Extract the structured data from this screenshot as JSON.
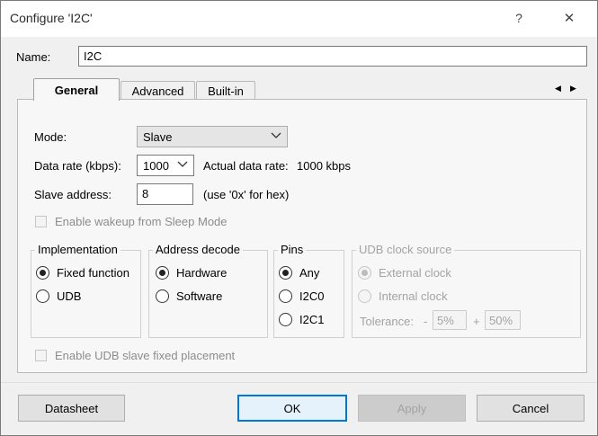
{
  "window": {
    "title": "Configure 'I2C'",
    "help_glyph": "?",
    "close_glyph": "✕"
  },
  "name_field": {
    "label": "Name:",
    "value": "I2C"
  },
  "tabs": [
    {
      "label": "General",
      "active": true
    },
    {
      "label": "Advanced",
      "active": false
    },
    {
      "label": "Built-in",
      "active": false
    }
  ],
  "tab_scroll": {
    "left": "◀",
    "right": "▶"
  },
  "general": {
    "mode": {
      "label": "Mode:",
      "value": "Slave"
    },
    "data_rate": {
      "label": "Data rate (kbps):",
      "value": "1000",
      "actual_label": "Actual data rate:",
      "actual_value": "1000 kbps"
    },
    "slave_address": {
      "label": "Slave address:",
      "value": "8",
      "hint": "(use '0x' for hex)"
    },
    "wakeup": {
      "label": "Enable wakeup from Sleep Mode",
      "checked": false,
      "enabled": false
    },
    "implementation": {
      "title": "Implementation",
      "options": [
        "Fixed function",
        "UDB"
      ],
      "selected": "Fixed function"
    },
    "address_decode": {
      "title": "Address decode",
      "options": [
        "Hardware",
        "Software"
      ],
      "selected": "Hardware"
    },
    "pins": {
      "title": "Pins",
      "options": [
        "Any",
        "I2C0",
        "I2C1"
      ],
      "selected": "Any"
    },
    "udb_clock": {
      "title": "UDB clock source",
      "options": [
        "External clock",
        "Internal clock"
      ],
      "selected": "External clock",
      "tolerance_label": "Tolerance:",
      "minus": "-",
      "plus": "+",
      "minus_value": "5%",
      "plus_value": "50%"
    },
    "fixed_placement": {
      "label": "Enable UDB slave fixed placement",
      "checked": false,
      "enabled": false
    }
  },
  "buttons": {
    "datasheet": "Datasheet",
    "ok": "OK",
    "apply": "Apply",
    "cancel": "Cancel"
  },
  "colors": {
    "accent": "#0078d7",
    "disabled_text": "#a3a3a3"
  }
}
